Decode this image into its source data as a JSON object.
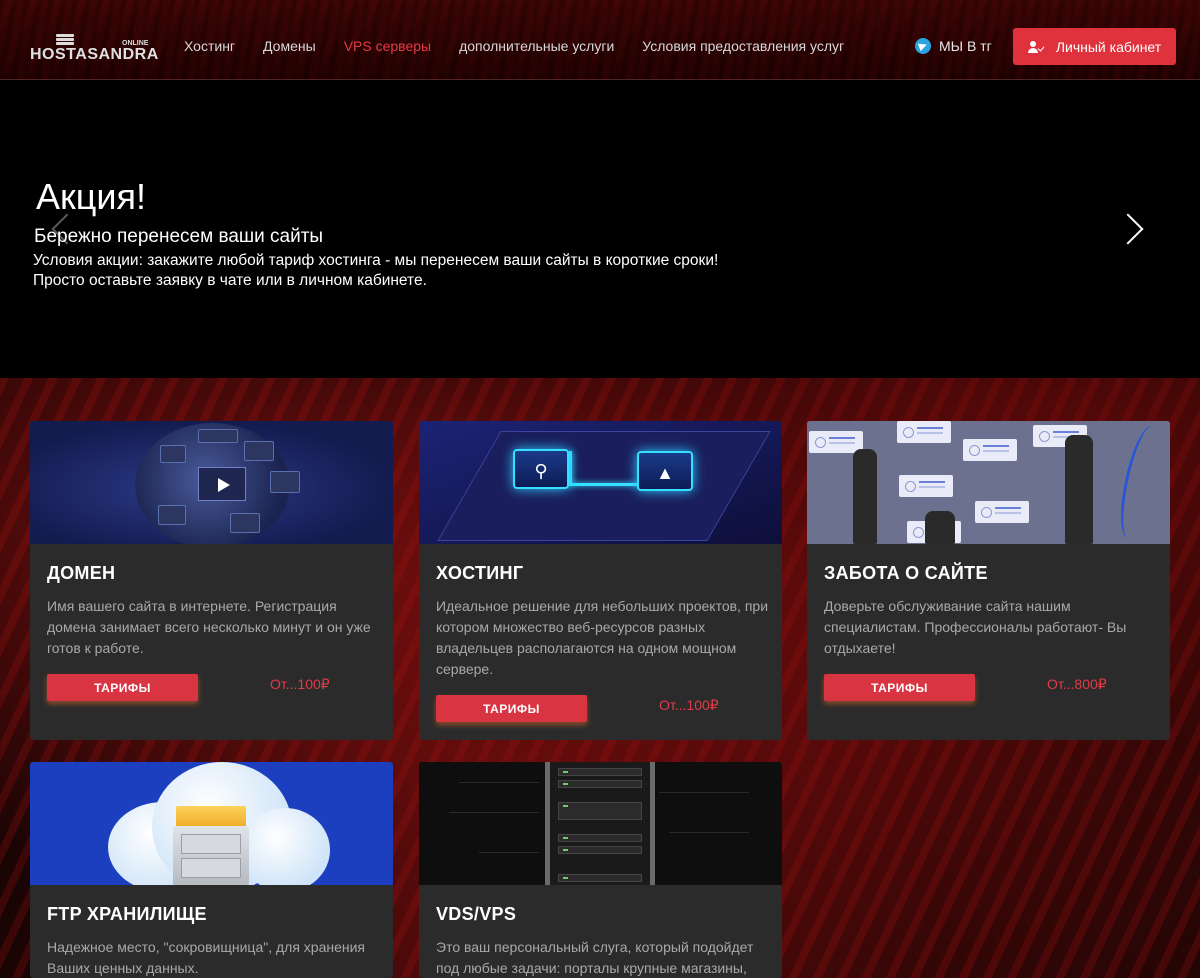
{
  "header": {
    "logo": {
      "text": "HOSTASANDRA",
      "badge": "ONLINE"
    },
    "nav": [
      {
        "label": "Хостинг",
        "active": false
      },
      {
        "label": "Домены",
        "active": false
      },
      {
        "label": "VPS серверы",
        "active": true
      },
      {
        "label": "дополнительные услуги",
        "active": false
      },
      {
        "label": "Условия предоставления услуг",
        "active": false
      }
    ],
    "telegram_label": "МЫ В тг",
    "cabinet_label": "Личный кабинет"
  },
  "hero": {
    "title": "Акция!",
    "subtitle": "Бережно перенесем ваши сайты",
    "line1": "Условия акции: закажите любой тариф хостинга - мы перенесем ваши сайты в короткие сроки!",
    "line2": "Просто оставьте заявку в чате или в личном кабинете."
  },
  "cards": [
    {
      "title": "ДОМЕН",
      "text": "Имя вашего сайта в интернете. Регистрация домена занимает всего несколько минут и он уже готов к работе.",
      "button": "ТАРИФЫ",
      "price": "От...100₽"
    },
    {
      "title": "ХОСТИНГ",
      "text": "Идеальное решение для небольших проектов, при котором множество веб-ресурсов разных владельцев располагаются на одном мощном сервере.",
      "button": "ТАРИФЫ",
      "price": "От...100₽"
    },
    {
      "title": "ЗАБОТА О САЙТЕ",
      "text": "Доверьте обслуживание сайта нашим специалистам. Профессионалы работают- Вы отдыхаете!",
      "button": "ТАРИФЫ",
      "price": "От...800₽"
    },
    {
      "title": "FTP ХРАНИЛИЩЕ",
      "text": "Надежное место, \"сокровищница\", для хранения Ваших ценных данных."
    },
    {
      "title": "VDS/VPS",
      "text": "Это ваш персональный слуга, который подойдет под любые задачи: порталы крупные магазины,"
    }
  ],
  "colors": {
    "accent": "#e0323c",
    "active_nav": "#e23b47",
    "card_bg": "#2b2b2b"
  }
}
